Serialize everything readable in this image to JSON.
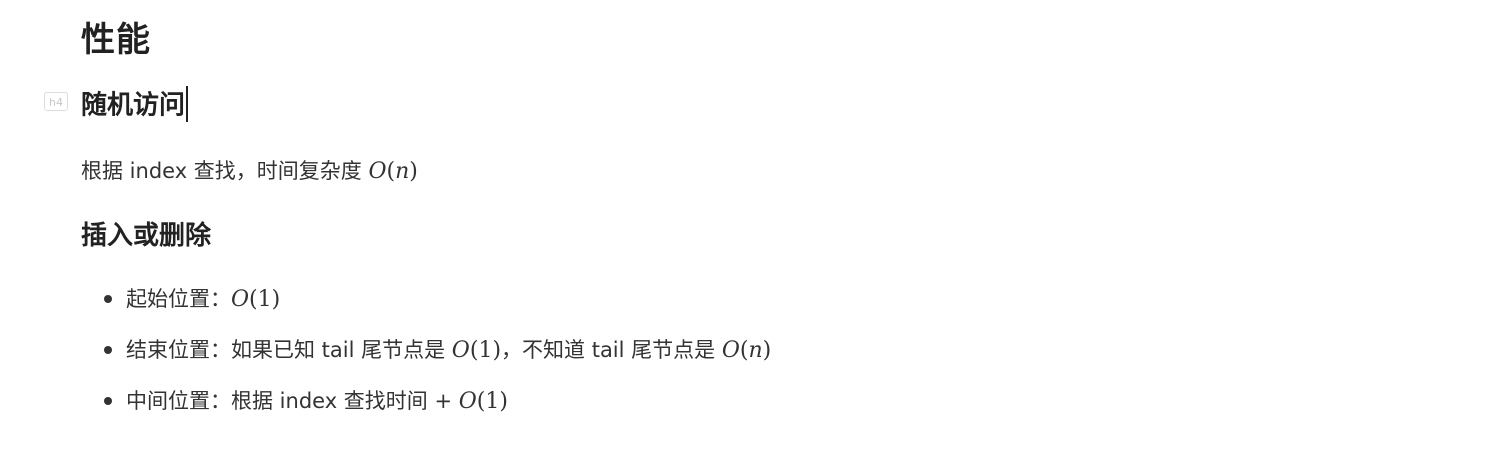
{
  "section_title": "性能",
  "random_access": {
    "heading_badge": "h4",
    "heading": "随机访问",
    "desc_text": "根据 index 查找，时间复杂度 ",
    "desc_math": "O(n)"
  },
  "insert_delete": {
    "heading": "插入或删除",
    "items": [
      {
        "label": "起始位置：",
        "math": "O(1)"
      },
      {
        "label": "结束位置：如果已知 tail 尾节点是 ",
        "math": "O(1)",
        "mid": "，不知道 tail 尾节点是 ",
        "math2": "O(n)"
      },
      {
        "label": "中间位置：根据 index 查找时间 + ",
        "math": "O(1)"
      }
    ]
  }
}
